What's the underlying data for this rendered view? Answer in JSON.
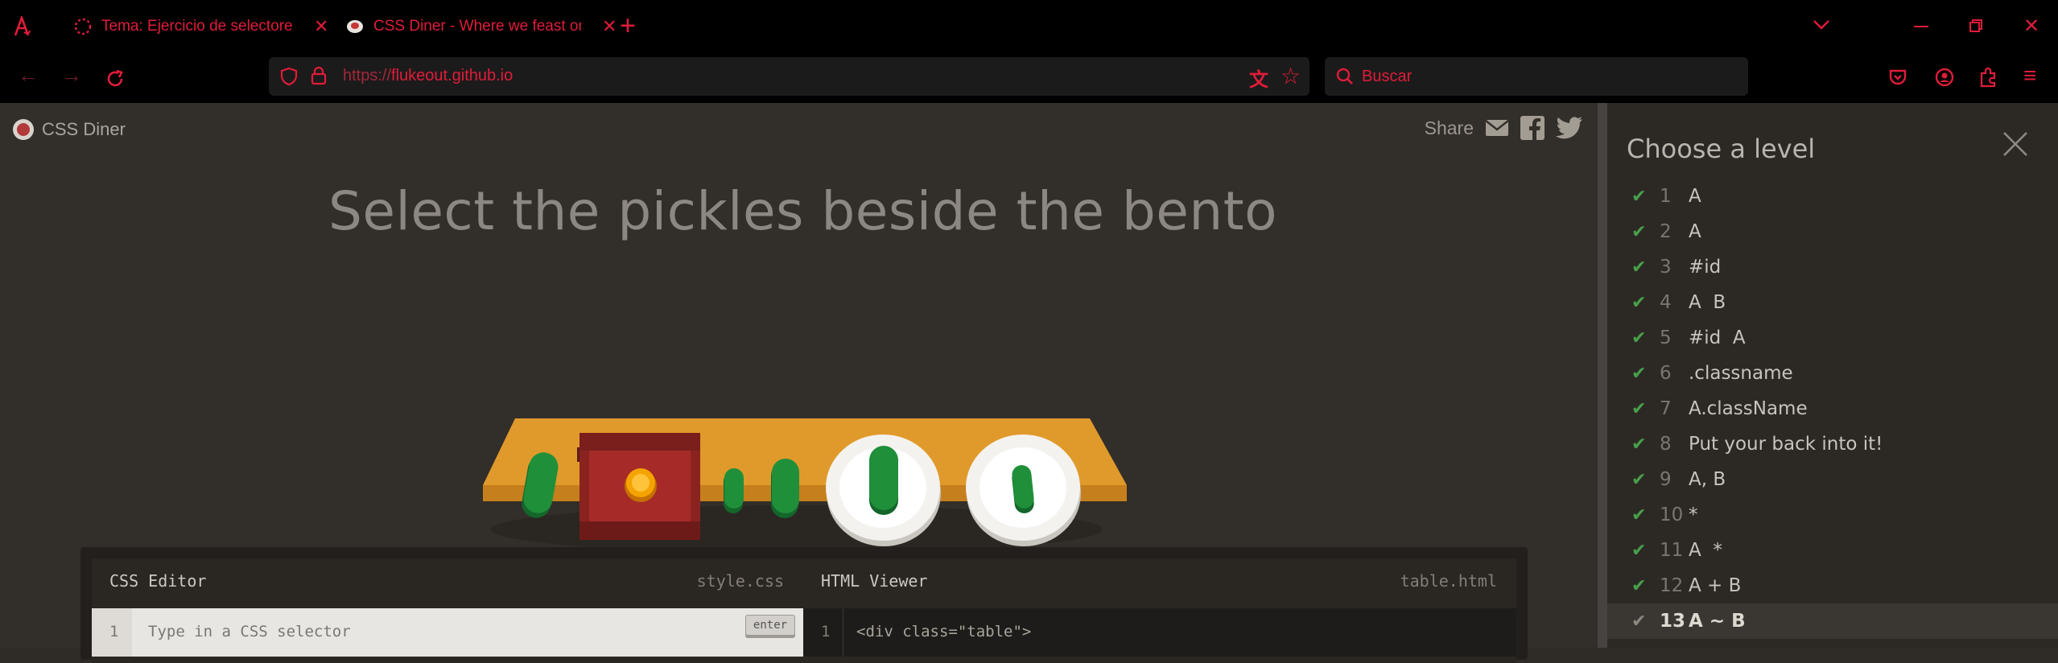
{
  "browser": {
    "tabs": [
      {
        "title": "Tema: Ejercicio de selectores de CSS",
        "active": false
      },
      {
        "title": "CSS Diner - Where we feast on CSS Selectors!",
        "active": true
      }
    ],
    "new_tab_icon": "plus-icon",
    "url_prefix": "https://",
    "url_domain": "flukeout.github.io",
    "search_placeholder": "Buscar"
  },
  "site": {
    "logo_text": "CSS Diner",
    "share_label": "Share"
  },
  "level": {
    "instruction": "Select the pickles beside the bento"
  },
  "editor": {
    "css_title": "CSS Editor",
    "css_file": "style.css",
    "html_title": "HTML Viewer",
    "html_file": "table.html",
    "line_number": "1",
    "input_placeholder": "Type in a CSS selector",
    "enter_label": "enter",
    "html_first_line": "<div class=\"table\">"
  },
  "sidebar": {
    "title": "Choose a level",
    "levels": [
      {
        "num": "1",
        "name": "A",
        "done": true
      },
      {
        "num": "2",
        "name": "A",
        "done": true
      },
      {
        "num": "3",
        "name": "#id",
        "done": true
      },
      {
        "num": "4",
        "name": "A  B",
        "done": true
      },
      {
        "num": "5",
        "name": "#id  A",
        "done": true
      },
      {
        "num": "6",
        "name": ".classname",
        "done": true
      },
      {
        "num": "7",
        "name": "A.className",
        "done": true
      },
      {
        "num": "8",
        "name": "Put your back into it!",
        "done": true
      },
      {
        "num": "9",
        "name": "A, B",
        "done": true
      },
      {
        "num": "10",
        "name": "*",
        "done": true
      },
      {
        "num": "11",
        "name": "A  *",
        "done": true
      },
      {
        "num": "12",
        "name": "A + B",
        "done": true
      },
      {
        "num": "13",
        "name": "A ~ B",
        "done": false,
        "current": true
      }
    ]
  },
  "colors": {
    "browser_accent": "#e01c3a",
    "page_bg": "#322e2a",
    "check_green": "#48a04b",
    "table_orange": "#e09a2b",
    "pickle_green": "#1f8f3a"
  }
}
